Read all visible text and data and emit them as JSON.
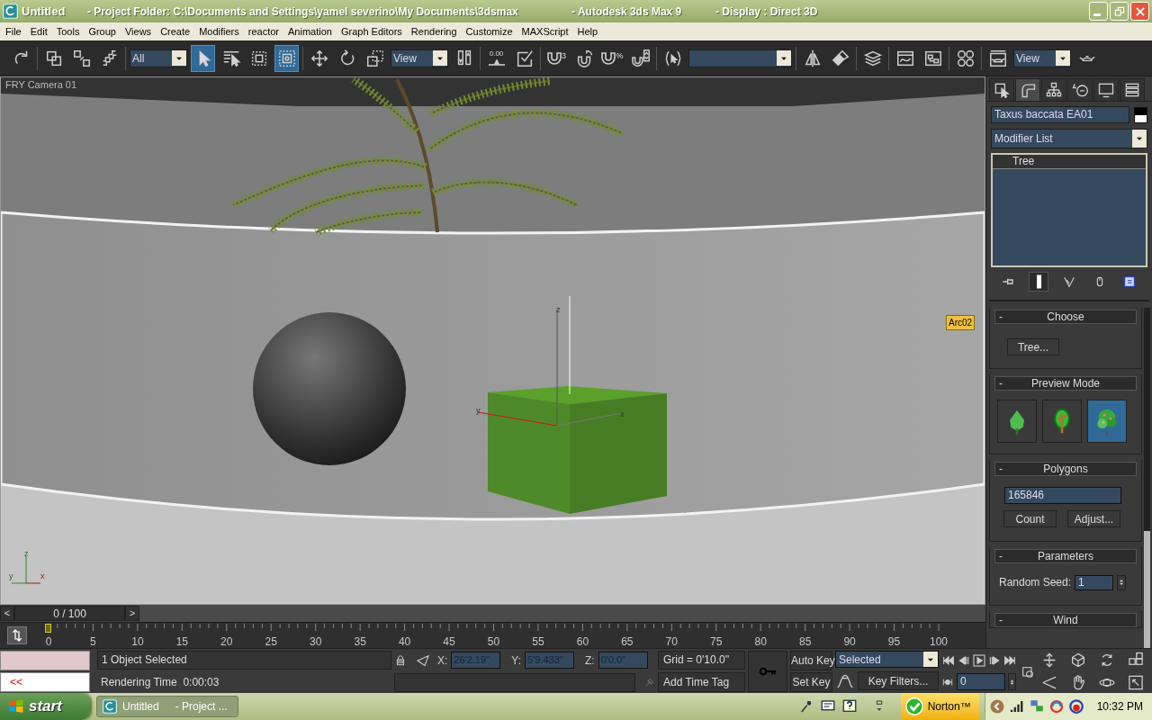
{
  "window": {
    "title": "Untitled",
    "title_parts": [
      "- Project Folder: C:\\Documents and Settings\\yamel severino\\My Documents\\3dsmax",
      "- Autodesk 3ds Max 9",
      "- Display : Direct 3D"
    ]
  },
  "menu": [
    "File",
    "Edit",
    "Tools",
    "Group",
    "Views",
    "Create",
    "Modifiers",
    "reactor",
    "Animation",
    "Graph Editors",
    "Rendering",
    "Customize",
    "MAXScript",
    "Help"
  ],
  "toolbar": [
    [
      {
        "kind": "button",
        "selected": false
      }
    ],
    [
      {
        "kind": "button",
        "selected": false
      },
      {
        "kind": "button",
        "selected": false
      },
      {
        "kind": "button",
        "selected": false
      }
    ],
    [
      {
        "kind": "dropdown",
        "value": "All"
      },
      {
        "kind": "button",
        "selected": true
      },
      {
        "kind": "button",
        "selected": false
      },
      {
        "kind": "button",
        "selected": false
      },
      {
        "kind": "button",
        "selected": true
      }
    ],
    [
      {
        "kind": "button",
        "selected": false
      },
      {
        "kind": "button",
        "selected": false
      },
      {
        "kind": "button",
        "selected": false
      },
      {
        "kind": "dropdown",
        "value": "View"
      },
      {
        "kind": "button",
        "selected": false
      }
    ],
    [
      {
        "kind": "button",
        "selected": false,
        "label": "0.00"
      },
      {
        "kind": "button"
      }
    ],
    [
      {
        "kind": "button",
        "selected": false,
        "label": "3"
      },
      {
        "kind": "button",
        "selected": false
      },
      {
        "kind": "button",
        "selected": false,
        "label": "%"
      },
      {
        "kind": "button",
        "selected": false
      }
    ],
    [
      {
        "kind": "button",
        "selected": false
      },
      {
        "kind": "dropdown"
      }
    ],
    [
      {
        "kind": "button",
        "selected": false
      },
      {
        "kind": "button",
        "selected": false
      }
    ],
    [
      {
        "kind": "button",
        "selected": false
      }
    ],
    [
      {
        "kind": "button",
        "selected": false
      },
      {
        "kind": "button",
        "selected": false
      }
    ],
    [
      {
        "kind": "button",
        "selected": false
      }
    ],
    [
      {
        "kind": "button",
        "selected": false
      },
      {
        "kind": "dropdown",
        "value": "View"
      },
      {
        "kind": "button",
        "selected": false
      }
    ]
  ],
  "viewport": {
    "label": "FRY Camera 01",
    "object_tag": "Arc02",
    "gizmo_axes": [
      "z",
      "y",
      "x"
    ],
    "tripod_axes": [
      "z",
      "y",
      "x"
    ]
  },
  "command_panel": {
    "tabs": [
      {
        "selected": false
      },
      {
        "selected": true
      },
      {
        "selected": false
      },
      {
        "selected": false
      },
      {
        "selected": false
      },
      {
        "selected": false
      }
    ],
    "object_name": "Taxus baccata EA01",
    "modifier_list": "Modifier List",
    "stack": [
      "Tree"
    ],
    "stack_buttons": [
      {
        "selected": false
      },
      {
        "selected": true
      },
      {
        "selected": false
      },
      {
        "selected": false
      },
      {
        "selected": false
      }
    ],
    "rollouts": [
      {
        "kind": "choose",
        "sign": "-",
        "title": "Choose",
        "button": "Tree..."
      },
      {
        "kind": "preview",
        "sign": "-",
        "title": "Preview Mode",
        "modes": [
          {
            "selected": false
          },
          {
            "selected": false
          },
          {
            "selected": true
          }
        ]
      },
      {
        "kind": "polygons",
        "sign": "-",
        "title": "Polygons",
        "value": "165846",
        "buttons": [
          "Count",
          "Adjust..."
        ]
      },
      {
        "kind": "parameters",
        "sign": "-",
        "title": "Parameters",
        "field_label": "Random Seed:",
        "value": "1"
      },
      {
        "kind": "collapsed",
        "sign": "-",
        "title": "Wind"
      }
    ]
  },
  "time_slider": {
    "prev": "<",
    "position": "0 / 100",
    "next": ">",
    "level": 0
  },
  "track_bar": {
    "ticks": [
      "0",
      "5",
      "10",
      "15",
      "20",
      "25",
      "30",
      "35",
      "40",
      "45",
      "50",
      "55",
      "60",
      "65",
      "70",
      "75",
      "80",
      "85",
      "90",
      "95",
      "100"
    ]
  },
  "status": {
    "script_output": "<<",
    "selection": "1 Object Selected",
    "prompt": "Rendering Time  0:00:03",
    "coords": [
      {
        "axis": "X:",
        "value": "26'2.19''"
      },
      {
        "axis": "Y:",
        "value": "5'9.433''"
      },
      {
        "axis": "Z:",
        "value": "0'0.0''"
      }
    ],
    "grid": "Grid = 0'10.0''",
    "time_tag": "Add Time Tag",
    "auto_key": "Auto Key",
    "set_key": "Set Key",
    "key_mode": "Selected",
    "key_filters": "Key Filters...",
    "frame": "0"
  },
  "taskbar": {
    "start": "start",
    "tasks": [
      {
        "title": "Untitled",
        "subtitle": "- Project ..."
      }
    ],
    "norton": "Norton™",
    "clock": "10:32 PM"
  }
}
